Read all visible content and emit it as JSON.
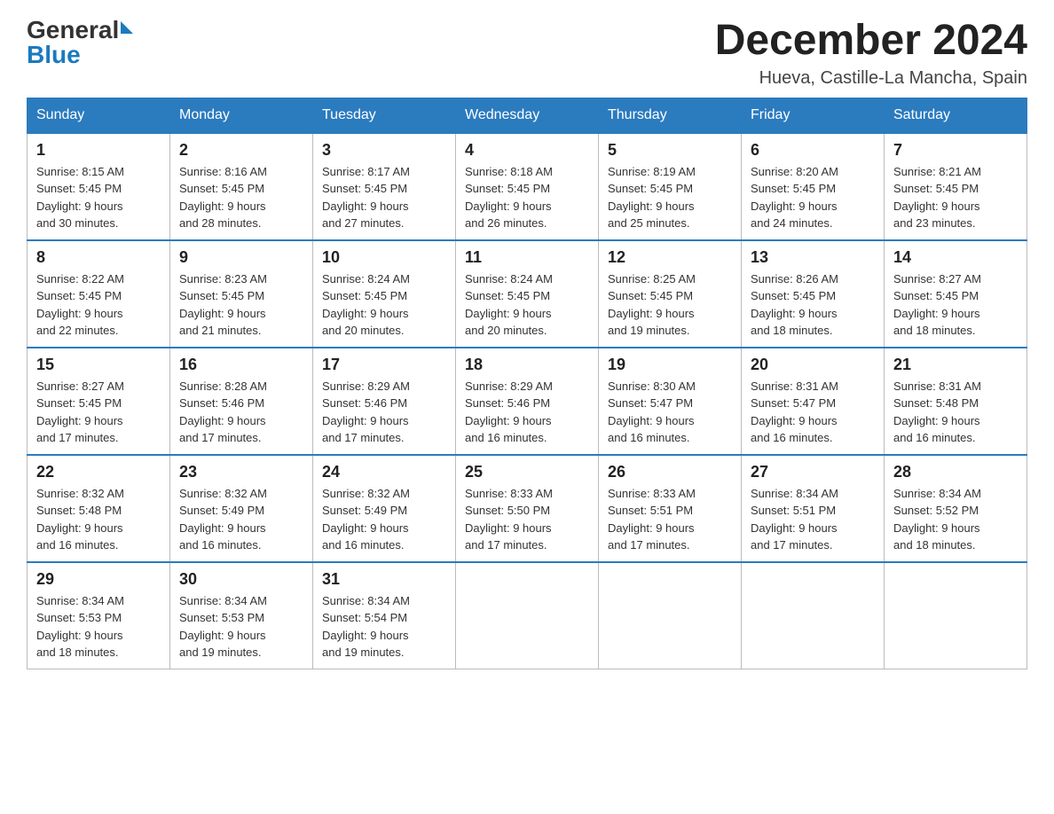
{
  "header": {
    "logo_general": "General",
    "logo_blue": "Blue",
    "month_title": "December 2024",
    "location": "Hueva, Castille-La Mancha, Spain"
  },
  "days_of_week": [
    "Sunday",
    "Monday",
    "Tuesday",
    "Wednesday",
    "Thursday",
    "Friday",
    "Saturday"
  ],
  "weeks": [
    [
      {
        "day": "1",
        "sunrise": "8:15 AM",
        "sunset": "5:45 PM",
        "daylight": "9 hours and 30 minutes."
      },
      {
        "day": "2",
        "sunrise": "8:16 AM",
        "sunset": "5:45 PM",
        "daylight": "9 hours and 28 minutes."
      },
      {
        "day": "3",
        "sunrise": "8:17 AM",
        "sunset": "5:45 PM",
        "daylight": "9 hours and 27 minutes."
      },
      {
        "day": "4",
        "sunrise": "8:18 AM",
        "sunset": "5:45 PM",
        "daylight": "9 hours and 26 minutes."
      },
      {
        "day": "5",
        "sunrise": "8:19 AM",
        "sunset": "5:45 PM",
        "daylight": "9 hours and 25 minutes."
      },
      {
        "day": "6",
        "sunrise": "8:20 AM",
        "sunset": "5:45 PM",
        "daylight": "9 hours and 24 minutes."
      },
      {
        "day": "7",
        "sunrise": "8:21 AM",
        "sunset": "5:45 PM",
        "daylight": "9 hours and 23 minutes."
      }
    ],
    [
      {
        "day": "8",
        "sunrise": "8:22 AM",
        "sunset": "5:45 PM",
        "daylight": "9 hours and 22 minutes."
      },
      {
        "day": "9",
        "sunrise": "8:23 AM",
        "sunset": "5:45 PM",
        "daylight": "9 hours and 21 minutes."
      },
      {
        "day": "10",
        "sunrise": "8:24 AM",
        "sunset": "5:45 PM",
        "daylight": "9 hours and 20 minutes."
      },
      {
        "day": "11",
        "sunrise": "8:24 AM",
        "sunset": "5:45 PM",
        "daylight": "9 hours and 20 minutes."
      },
      {
        "day": "12",
        "sunrise": "8:25 AM",
        "sunset": "5:45 PM",
        "daylight": "9 hours and 19 minutes."
      },
      {
        "day": "13",
        "sunrise": "8:26 AM",
        "sunset": "5:45 PM",
        "daylight": "9 hours and 18 minutes."
      },
      {
        "day": "14",
        "sunrise": "8:27 AM",
        "sunset": "5:45 PM",
        "daylight": "9 hours and 18 minutes."
      }
    ],
    [
      {
        "day": "15",
        "sunrise": "8:27 AM",
        "sunset": "5:45 PM",
        "daylight": "9 hours and 17 minutes."
      },
      {
        "day": "16",
        "sunrise": "8:28 AM",
        "sunset": "5:46 PM",
        "daylight": "9 hours and 17 minutes."
      },
      {
        "day": "17",
        "sunrise": "8:29 AM",
        "sunset": "5:46 PM",
        "daylight": "9 hours and 17 minutes."
      },
      {
        "day": "18",
        "sunrise": "8:29 AM",
        "sunset": "5:46 PM",
        "daylight": "9 hours and 16 minutes."
      },
      {
        "day": "19",
        "sunrise": "8:30 AM",
        "sunset": "5:47 PM",
        "daylight": "9 hours and 16 minutes."
      },
      {
        "day": "20",
        "sunrise": "8:31 AM",
        "sunset": "5:47 PM",
        "daylight": "9 hours and 16 minutes."
      },
      {
        "day": "21",
        "sunrise": "8:31 AM",
        "sunset": "5:48 PM",
        "daylight": "9 hours and 16 minutes."
      }
    ],
    [
      {
        "day": "22",
        "sunrise": "8:32 AM",
        "sunset": "5:48 PM",
        "daylight": "9 hours and 16 minutes."
      },
      {
        "day": "23",
        "sunrise": "8:32 AM",
        "sunset": "5:49 PM",
        "daylight": "9 hours and 16 minutes."
      },
      {
        "day": "24",
        "sunrise": "8:32 AM",
        "sunset": "5:49 PM",
        "daylight": "9 hours and 16 minutes."
      },
      {
        "day": "25",
        "sunrise": "8:33 AM",
        "sunset": "5:50 PM",
        "daylight": "9 hours and 17 minutes."
      },
      {
        "day": "26",
        "sunrise": "8:33 AM",
        "sunset": "5:51 PM",
        "daylight": "9 hours and 17 minutes."
      },
      {
        "day": "27",
        "sunrise": "8:34 AM",
        "sunset": "5:51 PM",
        "daylight": "9 hours and 17 minutes."
      },
      {
        "day": "28",
        "sunrise": "8:34 AM",
        "sunset": "5:52 PM",
        "daylight": "9 hours and 18 minutes."
      }
    ],
    [
      {
        "day": "29",
        "sunrise": "8:34 AM",
        "sunset": "5:53 PM",
        "daylight": "9 hours and 18 minutes."
      },
      {
        "day": "30",
        "sunrise": "8:34 AM",
        "sunset": "5:53 PM",
        "daylight": "9 hours and 19 minutes."
      },
      {
        "day": "31",
        "sunrise": "8:34 AM",
        "sunset": "5:54 PM",
        "daylight": "9 hours and 19 minutes."
      },
      null,
      null,
      null,
      null
    ]
  ],
  "labels": {
    "sunrise": "Sunrise:",
    "sunset": "Sunset:",
    "daylight": "Daylight:"
  }
}
